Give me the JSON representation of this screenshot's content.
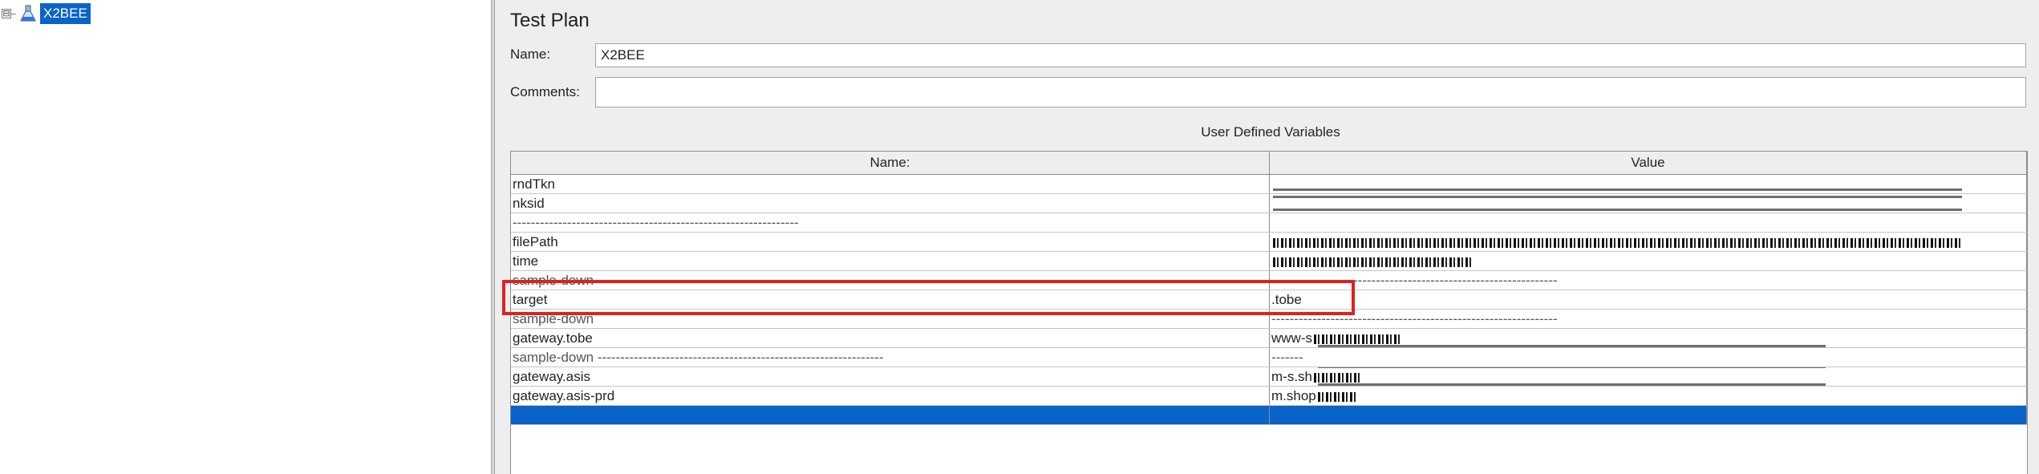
{
  "tree": {
    "root_label": "X2BEE",
    "expander": "⊟"
  },
  "panel": {
    "title": "Test Plan",
    "name_label": "Name:",
    "name_value": "X2BEE",
    "comments_label": "Comments:",
    "comments_value": ""
  },
  "variables": {
    "section_title": "User Defined Variables",
    "headers": {
      "name": "Name:",
      "value": "Value"
    },
    "rows": [
      {
        "name": "rndTkn",
        "value": ""
      },
      {
        "name": "nksid",
        "value": ""
      },
      {
        "name": "---------------------------------------------------------------",
        "value": ""
      },
      {
        "name": "filePath",
        "value": ""
      },
      {
        "name": "time",
        "value": ""
      },
      {
        "name": "sample-down",
        "value": "---------------------------------------------------------------"
      },
      {
        "name": "target",
        "value": ".tobe"
      },
      {
        "name": "sample-down",
        "value": "---------------------------------------------------------------"
      },
      {
        "name": "gateway.tobe",
        "value": "www-s"
      },
      {
        "name": "sample-down ---------------------------------------------------------------",
        "value": "-------"
      },
      {
        "name": "gateway.asis",
        "value": "m-s.sh"
      },
      {
        "name": "gateway.asis-prd",
        "value": "m.shop"
      },
      {
        "name": "",
        "value": ""
      }
    ]
  },
  "colors": {
    "selection": "#0a63c9",
    "highlight": "#e02020"
  }
}
